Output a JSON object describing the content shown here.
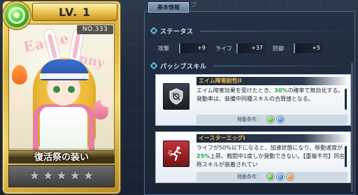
{
  "background": {
    "ghost_tab": "ップ"
  },
  "card": {
    "level": "LV.  1",
    "card_number": "NO.333",
    "name": "復活祭の装い",
    "art_text_1": "Easte",
    "art_text_2": "nny",
    "stars": [
      "★",
      "★",
      "★",
      "★",
      "★"
    ],
    "element": "green-element-icon",
    "frame_color": "#e0b83d"
  },
  "panel": {
    "tab_label": "基本情報",
    "status_section": {
      "title": "ステータス",
      "stats": [
        {
          "key": "攻撃",
          "value": "+9"
        },
        {
          "key": "ライフ",
          "value": "+37"
        },
        {
          "key": "防御",
          "value": "+5"
        }
      ]
    },
    "passive_section": {
      "title": "パッシブスキル",
      "skills": [
        {
          "name": "エイム障害耐性II",
          "desc_pre": "エイム障害効果を受けたとき、",
          "desc_highlight": "30%",
          "desc_post": "の確率で無効化する。発動率は、装備中同種スキルの合算値となる。",
          "condition_label": "発動条件：",
          "conditions": [
            "green",
            "blue"
          ],
          "icon": "shield-icon"
        },
        {
          "name": "イースターエッグI",
          "desc_pre": "ライフが50%以下になると、加速状態になり、移動速度が",
          "desc_highlight": "25%",
          "desc_post": "上昇。戦闘中1度しか発動できない。【重複不可】同名称スキルが装着されてい",
          "condition_label": "発動条件：",
          "conditions": [
            "green",
            "blue",
            "orange"
          ],
          "icon": "running-man-icon"
        }
      ]
    }
  }
}
